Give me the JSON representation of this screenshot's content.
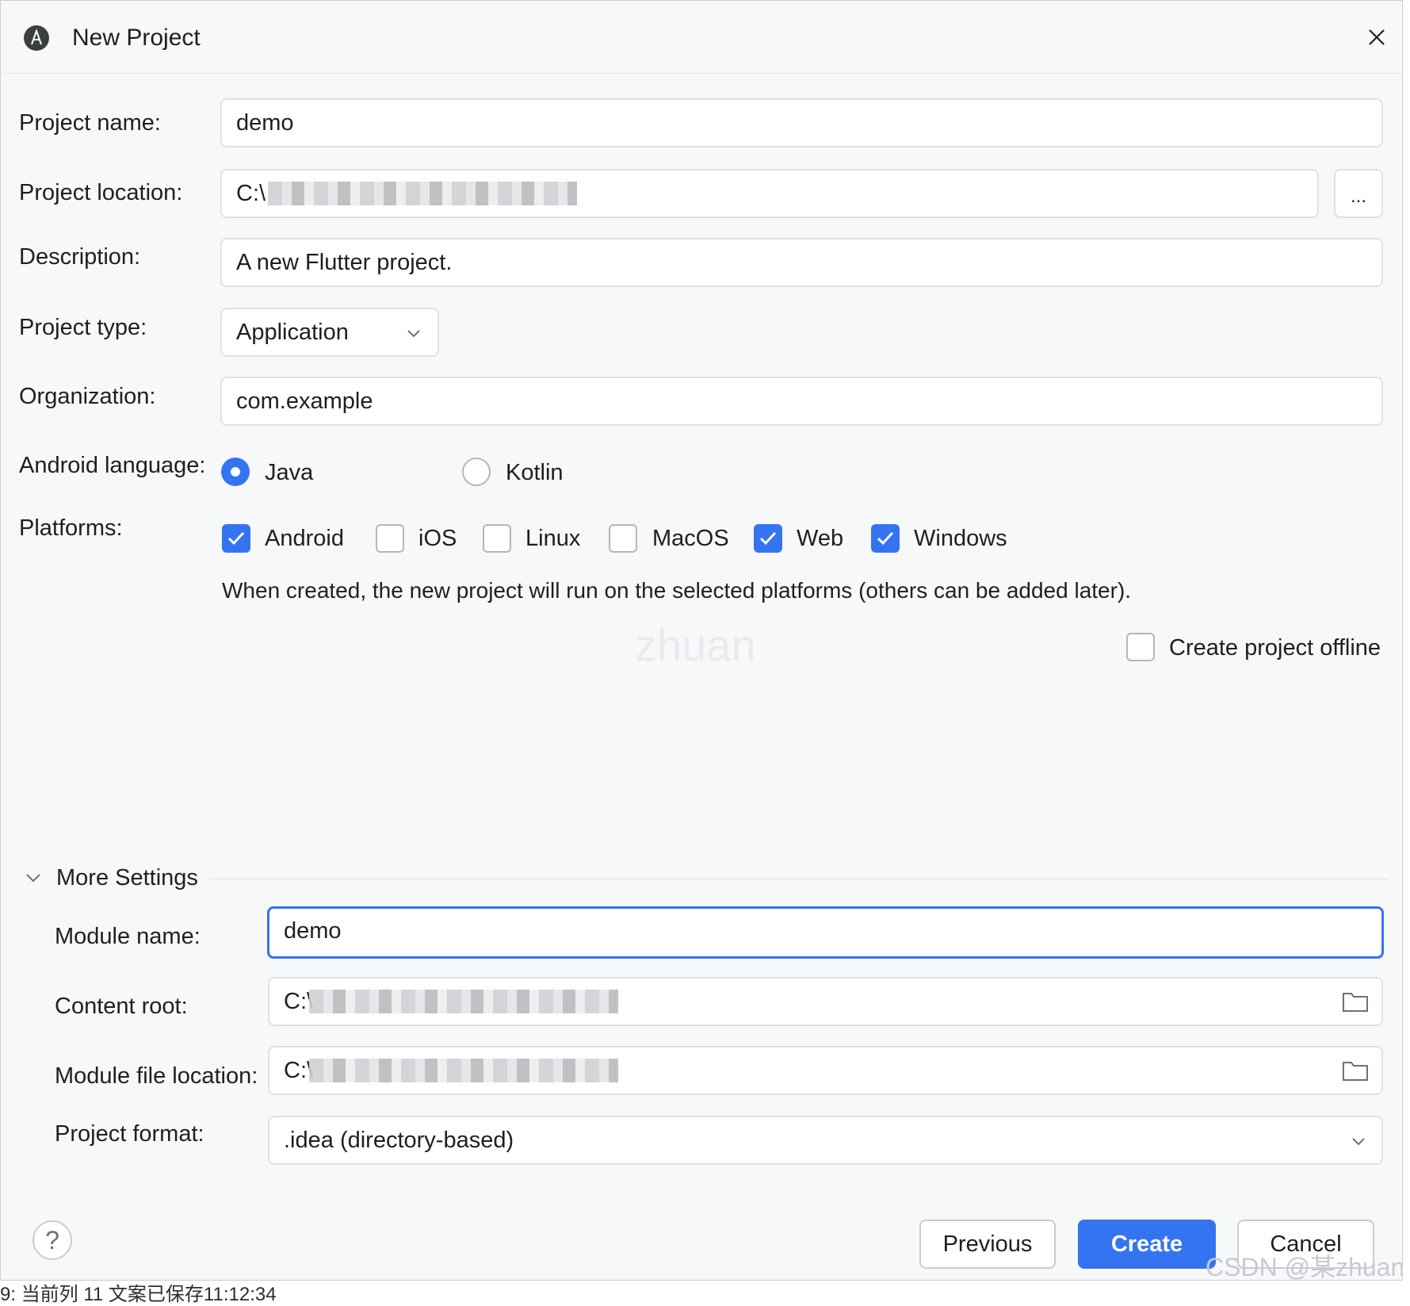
{
  "dialog": {
    "title": "New Project"
  },
  "form": {
    "project_name": {
      "label": "Project name:",
      "value": "demo"
    },
    "project_location": {
      "label": "Project location:",
      "value_prefix": "C:\\",
      "browse_label": "..."
    },
    "description": {
      "label": "Description:",
      "value": "A new Flutter project."
    },
    "project_type": {
      "label": "Project type:",
      "value": "Application"
    },
    "organization": {
      "label": "Organization:",
      "value": "com.example"
    },
    "android_language": {
      "label": "Android language:",
      "options": [
        {
          "label": "Java",
          "selected": true
        },
        {
          "label": "Kotlin",
          "selected": false
        }
      ]
    },
    "platforms": {
      "label": "Platforms:",
      "options": [
        {
          "label": "Android",
          "checked": true
        },
        {
          "label": "iOS",
          "checked": false
        },
        {
          "label": "Linux",
          "checked": false
        },
        {
          "label": "MacOS",
          "checked": false
        },
        {
          "label": "Web",
          "checked": true
        },
        {
          "label": "Windows",
          "checked": true
        }
      ],
      "hint": "When created, the new project will run on the selected platforms (others can be added later)."
    },
    "offline": {
      "label": "Create project offline",
      "checked": false
    }
  },
  "more_settings": {
    "title": "More Settings",
    "module_name": {
      "label": "Module name:",
      "value": "demo"
    },
    "content_root": {
      "label": "Content root:",
      "value_prefix": "C:\\"
    },
    "module_file_location": {
      "label": "Module file location:",
      "value_prefix": "C:\\"
    },
    "project_format": {
      "label": "Project format:",
      "value": ".idea (directory-based)"
    }
  },
  "footer": {
    "help_label": "?",
    "previous_label": "Previous",
    "create_label": "Create",
    "cancel_label": "Cancel"
  },
  "overlay": {
    "watermark_mid": "zhuan",
    "csdn_watermark": "CSDN @某zhuan",
    "status_text": "9: 当前列 11 文案已保存11:12:34"
  },
  "colors": {
    "accent": "#3574f0",
    "background": "#f7f8fa",
    "border": "#dfe1e5"
  }
}
